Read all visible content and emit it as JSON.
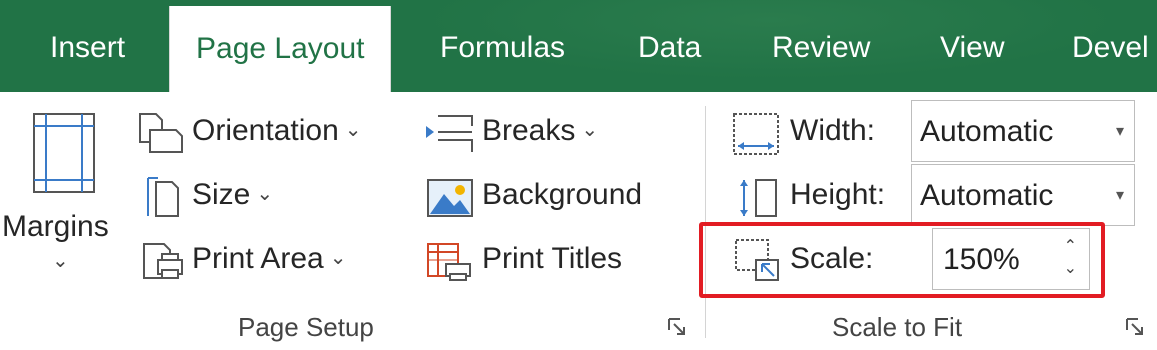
{
  "tabs": [
    {
      "label": "Insert"
    },
    {
      "label": "Page Layout"
    },
    {
      "label": "Formulas"
    },
    {
      "label": "Data"
    },
    {
      "label": "Review"
    },
    {
      "label": "View"
    },
    {
      "label": "Devel"
    }
  ],
  "active_tab": "Page Layout",
  "page_setup": {
    "margins_label": "Margins",
    "orientation_label": "Orientation",
    "size_label": "Size",
    "print_area_label": "Print Area",
    "breaks_label": "Breaks",
    "background_label": "Background",
    "print_titles_label": "Print Titles",
    "group_label": "Page Setup"
  },
  "scale_to_fit": {
    "width_label": "Width:",
    "width_value": "Automatic",
    "height_label": "Height:",
    "height_value": "Automatic",
    "scale_label": "Scale:",
    "scale_value": "150%",
    "group_label": "Scale to Fit"
  },
  "icons": {
    "margins": "margins-icon",
    "orientation": "orientation-icon",
    "size": "size-icon",
    "print_area": "print-area-icon",
    "breaks": "breaks-icon",
    "background": "background-icon",
    "print_titles": "print-titles-icon",
    "width": "width-icon",
    "height": "height-icon",
    "scale": "scale-icon"
  },
  "colors": {
    "tab_bar": "#217346",
    "active_tab_text": "#217346",
    "highlight": "#e21c23"
  }
}
